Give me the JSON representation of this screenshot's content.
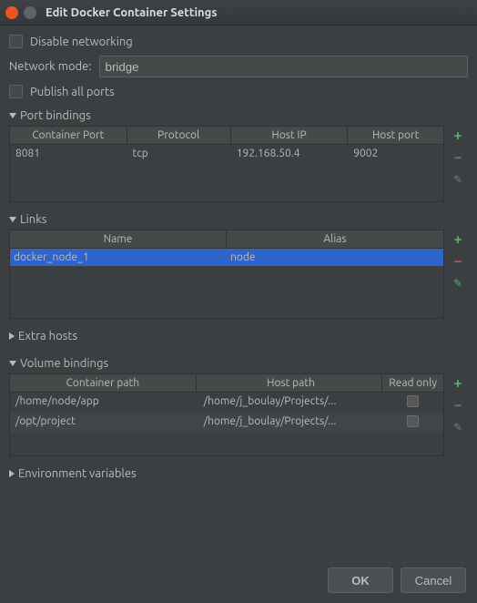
{
  "window": {
    "title": "Edit Docker Container Settings"
  },
  "form": {
    "disable_networking_label": "Disable networking",
    "network_mode_label": "Network mode:",
    "network_mode_value": "bridge",
    "publish_all_ports_label": "Publish all ports"
  },
  "sections": {
    "port_bindings": {
      "title": "Port bindings",
      "headers": {
        "cp": "Container Port",
        "pr": "Protocol",
        "hi": "Host IP",
        "hp": "Host port"
      },
      "rows": [
        {
          "cp": "8081",
          "pr": "tcp",
          "hi": "192.168.50.4",
          "hp": "9002"
        }
      ]
    },
    "links": {
      "title": "Links",
      "headers": {
        "name": "Name",
        "alias": "Alias"
      },
      "rows": [
        {
          "name": "docker_node_1",
          "alias": "node"
        }
      ]
    },
    "extra_hosts": {
      "title": "Extra hosts"
    },
    "volumes": {
      "title": "Volume bindings",
      "headers": {
        "cp": "Container path",
        "hp": "Host path",
        "ro": "Read only"
      },
      "rows": [
        {
          "cp": "/home/node/app",
          "hp": "/home/j_boulay/Projects/...",
          "ro": false
        },
        {
          "cp": "/opt/project",
          "hp": "/home/j_boulay/Projects/...",
          "ro": false
        }
      ]
    },
    "env": {
      "title": "Environment variables"
    }
  },
  "buttons": {
    "ok": "OK",
    "cancel": "Cancel"
  }
}
